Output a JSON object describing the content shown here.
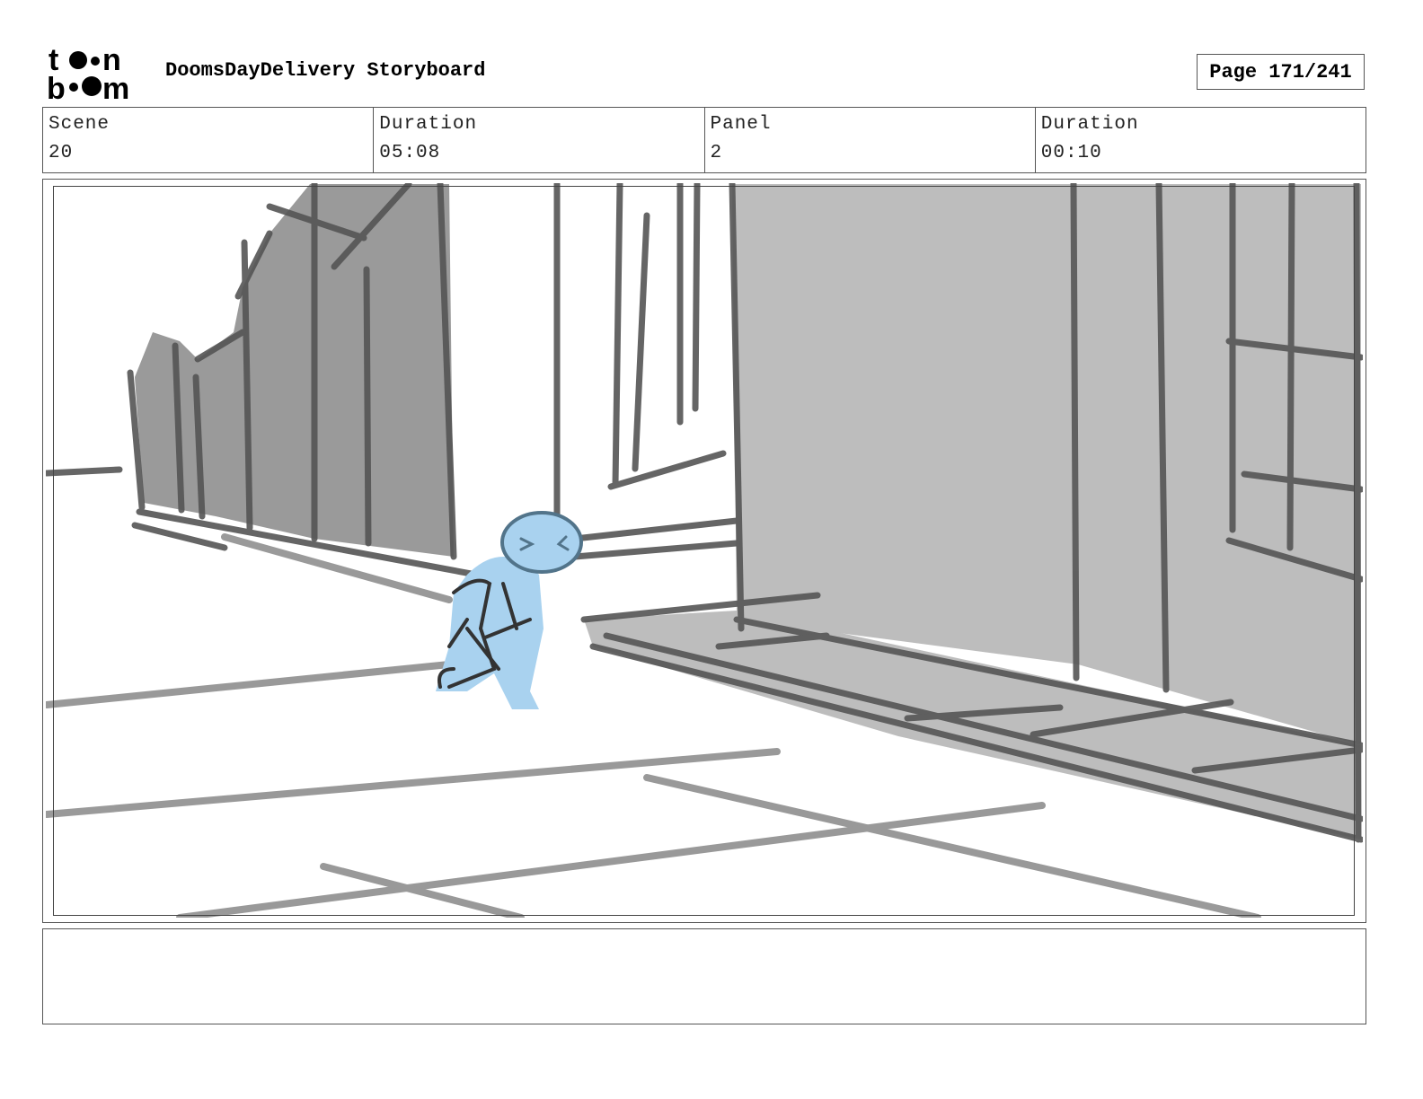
{
  "header": {
    "logo_text": "toon boom",
    "title": "DoomsDayDelivery Storyboard",
    "page_label": "Page 171/241"
  },
  "info": {
    "scene_label": "Scene",
    "scene_value": "20",
    "scene_duration_label": "Duration",
    "scene_duration_value": "05:08",
    "panel_label": "Panel",
    "panel_value": "2",
    "panel_duration_label": "Duration",
    "panel_duration_value": "00:10"
  },
  "panel": {
    "sketch_colors": {
      "wall_fill": "#bdbdbd",
      "dark_fill": "#9a9a9a",
      "line": "#555555",
      "character": "#a9d2ef"
    }
  },
  "notes": {
    "text": ""
  }
}
